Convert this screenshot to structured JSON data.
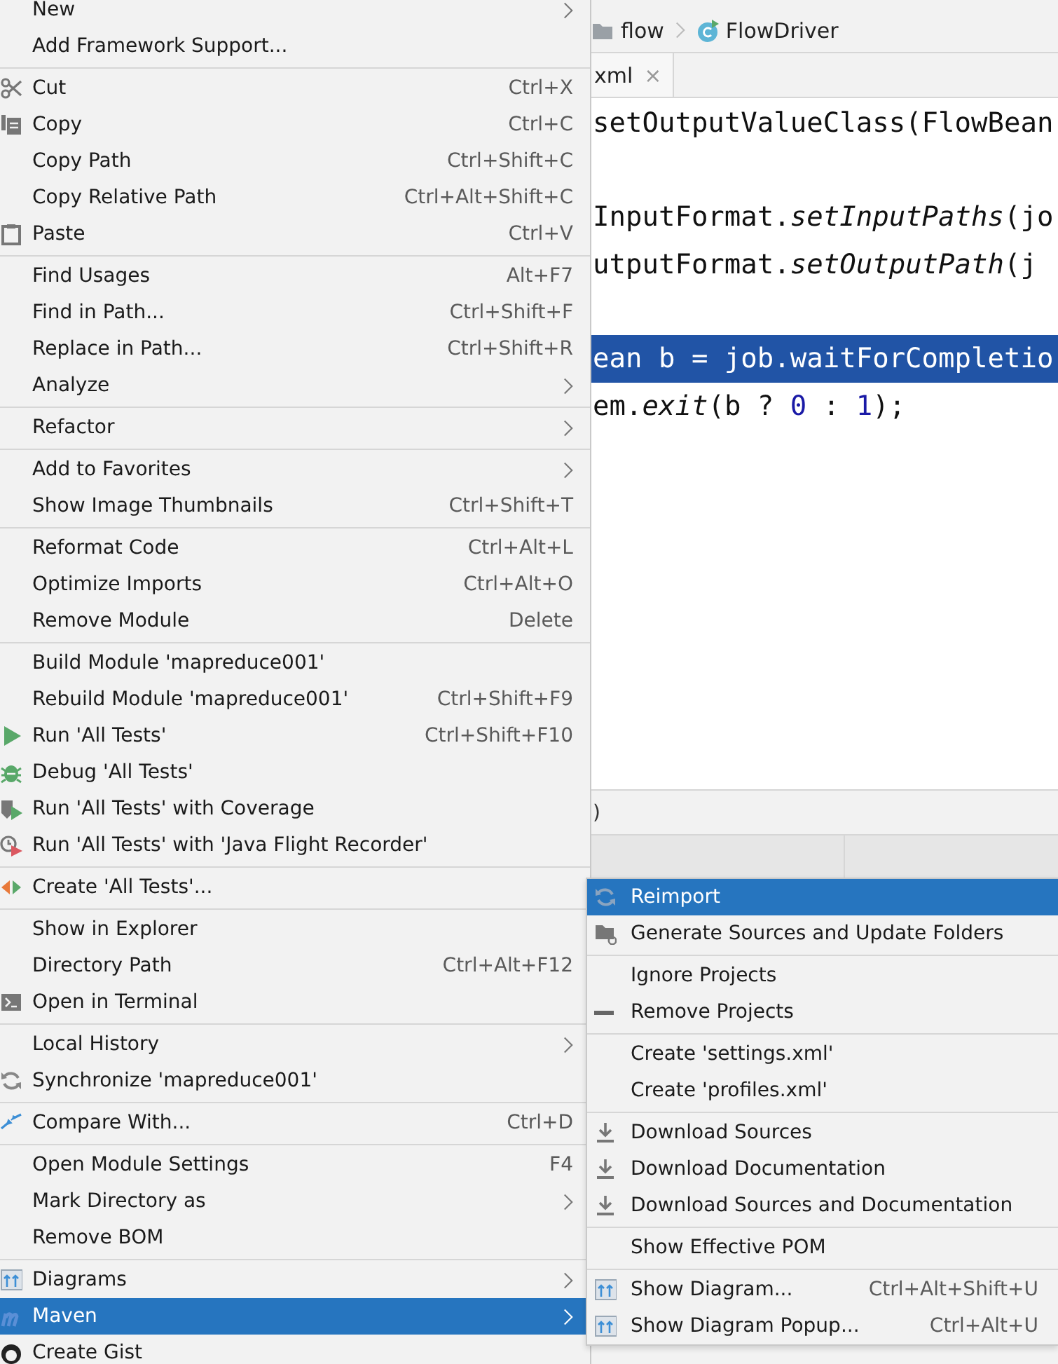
{
  "context_menu": {
    "groups": [
      {
        "items": [
          {
            "label": "New",
            "kind": "plain",
            "submenu": true,
            "selected": false
          },
          {
            "label": "Add Framework Support...",
            "kind": "plain",
            "submenu": false,
            "selected": false
          }
        ]
      },
      {
        "items": [
          {
            "label": "Cut",
            "shortcut": "Ctrl+X",
            "kind": "scissors",
            "submenu": false,
            "selected": false
          },
          {
            "label": "Copy",
            "shortcut": "Ctrl+C",
            "kind": "copy",
            "submenu": false,
            "selected": false
          },
          {
            "label": "Copy Path",
            "shortcut": "Ctrl+Shift+C",
            "kind": "plain",
            "submenu": false,
            "selected": false
          },
          {
            "label": "Copy Relative Path",
            "shortcut": "Ctrl+Alt+Shift+C",
            "kind": "plain",
            "submenu": false,
            "selected": false
          },
          {
            "label": "Paste",
            "shortcut": "Ctrl+V",
            "kind": "clipboard",
            "submenu": false,
            "selected": false
          }
        ]
      },
      {
        "items": [
          {
            "label": "Find Usages",
            "shortcut": "Alt+F7",
            "kind": "plain",
            "submenu": false,
            "selected": false
          },
          {
            "label": "Find in Path...",
            "shortcut": "Ctrl+Shift+F",
            "kind": "plain",
            "submenu": false,
            "selected": false
          },
          {
            "label": "Replace in Path...",
            "shortcut": "Ctrl+Shift+R",
            "kind": "plain",
            "submenu": false,
            "selected": false
          },
          {
            "label": "Analyze",
            "kind": "plain",
            "submenu": true,
            "selected": false
          }
        ]
      },
      {
        "items": [
          {
            "label": "Refactor",
            "kind": "plain",
            "submenu": true,
            "selected": false
          }
        ]
      },
      {
        "items": [
          {
            "label": "Add to Favorites",
            "kind": "plain",
            "submenu": true,
            "selected": false
          },
          {
            "label": "Show Image Thumbnails",
            "shortcut": "Ctrl+Shift+T",
            "kind": "plain",
            "submenu": false,
            "selected": false
          }
        ]
      },
      {
        "items": [
          {
            "label": "Reformat Code",
            "shortcut": "Ctrl+Alt+L",
            "kind": "plain",
            "submenu": false,
            "selected": false
          },
          {
            "label": "Optimize Imports",
            "shortcut": "Ctrl+Alt+O",
            "kind": "plain",
            "submenu": false,
            "selected": false
          },
          {
            "label": "Remove Module",
            "shortcut": "Delete",
            "kind": "plain",
            "submenu": false,
            "selected": false
          }
        ]
      },
      {
        "items": [
          {
            "label": "Build Module 'mapreduce001'",
            "kind": "plain",
            "submenu": false,
            "selected": false
          },
          {
            "label": "Rebuild Module 'mapreduce001'",
            "shortcut": "Ctrl+Shift+F9",
            "kind": "plain",
            "submenu": false,
            "selected": false
          },
          {
            "label": "Run 'All Tests'",
            "shortcut": "Ctrl+Shift+F10",
            "kind": "play",
            "submenu": false,
            "selected": false
          },
          {
            "label": "Debug 'All Tests'",
            "kind": "bug",
            "submenu": false,
            "selected": false
          },
          {
            "label": "Run 'All Tests' with Coverage",
            "kind": "coverage",
            "submenu": false,
            "selected": false
          },
          {
            "label": "Run 'All Tests' with 'Java Flight Recorder'",
            "kind": "timer",
            "submenu": false,
            "selected": false
          }
        ]
      },
      {
        "items": [
          {
            "label": "Create 'All Tests'...",
            "kind": "create-test",
            "submenu": false,
            "selected": false
          }
        ]
      },
      {
        "items": [
          {
            "label": "Show in Explorer",
            "kind": "plain",
            "submenu": false,
            "selected": false
          },
          {
            "label": "Directory Path",
            "shortcut": "Ctrl+Alt+F12",
            "kind": "plain",
            "submenu": false,
            "selected": false
          },
          {
            "label": "Open in Terminal",
            "kind": "terminal",
            "submenu": false,
            "selected": false
          }
        ]
      },
      {
        "items": [
          {
            "label": "Local History",
            "kind": "plain",
            "submenu": true,
            "selected": false
          },
          {
            "label": "Synchronize 'mapreduce001'",
            "kind": "sync",
            "submenu": false,
            "selected": false
          }
        ]
      },
      {
        "items": [
          {
            "label": "Compare With...",
            "shortcut": "Ctrl+D",
            "kind": "compare",
            "submenu": false,
            "selected": false
          }
        ]
      },
      {
        "items": [
          {
            "label": "Open Module Settings",
            "shortcut": "F4",
            "kind": "plain",
            "submenu": false,
            "selected": false
          },
          {
            "label": "Mark Directory as",
            "kind": "plain",
            "submenu": true,
            "selected": false
          },
          {
            "label": "Remove BOM",
            "kind": "plain",
            "submenu": false,
            "selected": false
          }
        ]
      },
      {
        "items": [
          {
            "label": "Diagrams",
            "kind": "diagram",
            "submenu": true,
            "selected": false
          },
          {
            "label": "Maven",
            "kind": "maven",
            "submenu": true,
            "selected": true
          },
          {
            "label": "Create Gist",
            "kind": "gist",
            "submenu": false,
            "selected": false
          }
        ]
      }
    ]
  },
  "editor": {
    "breadcrumb": [
      {
        "label": "flow",
        "kind": "folder"
      },
      {
        "label": "FlowDriver",
        "kind": "class"
      }
    ],
    "tab": {
      "label": "xml",
      "close": "×"
    },
    "code_lines": [
      {
        "selected": false,
        "tokens": [
          {
            "text": "setOutputValueClass(FlowBean",
            "kind": "plain"
          }
        ]
      },
      {
        "selected": false
      },
      {
        "selected": false,
        "tokens": [
          {
            "text": "InputFormat.",
            "kind": "plain"
          },
          {
            "text": "setInputPaths",
            "kind": "italic"
          },
          {
            "text": "(jo",
            "kind": "plain"
          }
        ]
      },
      {
        "selected": false,
        "tokens": [
          {
            "text": "utputFormat.",
            "kind": "plain"
          },
          {
            "text": "setOutputPath",
            "kind": "italic"
          },
          {
            "text": "(j",
            "kind": "plain"
          }
        ]
      },
      {
        "selected": false
      },
      {
        "selected": true,
        "tokens": [
          {
            "text": "ean b = job.waitForCompletio",
            "kind": "plain"
          }
        ]
      },
      {
        "selected": false,
        "tokens": [
          {
            "text": "em.",
            "kind": "plain"
          },
          {
            "text": "exit",
            "kind": "italic"
          },
          {
            "text": "(b ? ",
            "kind": "plain"
          },
          {
            "text": "0",
            "kind": "number"
          },
          {
            "text": " : ",
            "kind": "plain"
          },
          {
            "text": "1",
            "kind": "number"
          },
          {
            "text": ");",
            "kind": "plain"
          }
        ]
      }
    ],
    "panel_text": ")"
  },
  "maven_submenu": {
    "groups": [
      {
        "items": [
          {
            "label": "Reimport",
            "kind": "refresh",
            "selected": true
          },
          {
            "label": "Generate Sources and Update Folders",
            "kind": "folder-sync",
            "selected": false
          }
        ]
      },
      {
        "items": [
          {
            "label": "Ignore Projects",
            "kind": "plain",
            "selected": false
          },
          {
            "label": "Remove Projects",
            "kind": "minus",
            "selected": false
          }
        ]
      },
      {
        "items": [
          {
            "label": "Create 'settings.xml'",
            "kind": "plain",
            "selected": false
          },
          {
            "label": "Create 'profiles.xml'",
            "kind": "plain",
            "selected": false
          }
        ]
      },
      {
        "items": [
          {
            "label": "Download Sources",
            "kind": "download",
            "selected": false
          },
          {
            "label": "Download Documentation",
            "kind": "download",
            "selected": false
          },
          {
            "label": "Download Sources and Documentation",
            "kind": "download",
            "selected": false
          }
        ]
      },
      {
        "items": [
          {
            "label": "Show Effective POM",
            "kind": "plain",
            "selected": false
          }
        ]
      },
      {
        "items": [
          {
            "label": "Show Diagram...",
            "shortcut": "Ctrl+Alt+Shift+U",
            "kind": "diagram",
            "selected": false
          },
          {
            "label": "Show Diagram Popup...",
            "shortcut": "Ctrl+Alt+U",
            "kind": "diagram",
            "selected": false
          }
        ]
      }
    ]
  }
}
